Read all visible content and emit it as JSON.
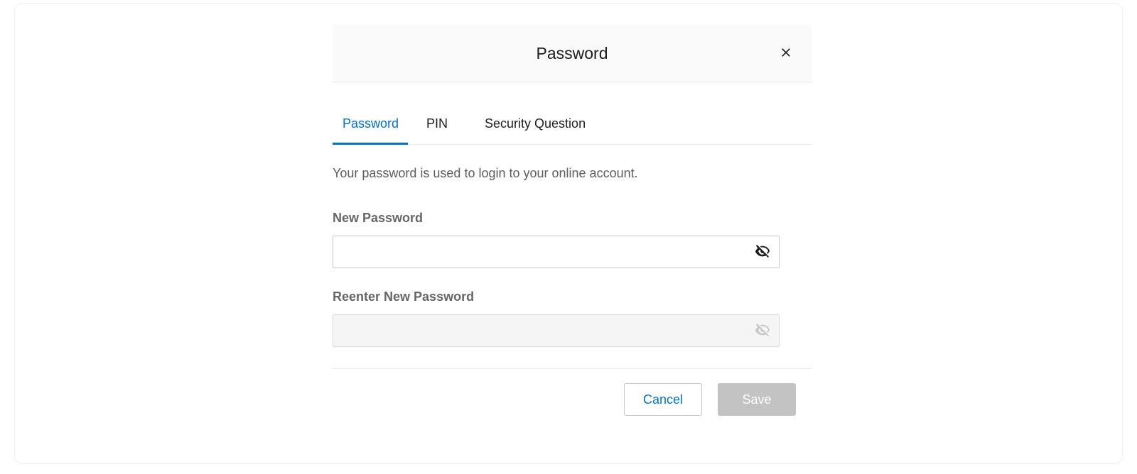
{
  "colors": {
    "primary": "#0073cf",
    "text": "#1d1d1d",
    "muted": "#5c5c5c",
    "label": "#666666",
    "border": "#c7c7c7",
    "disabled_bg": "#f5f5f5",
    "save_disabled_bg": "#c3c3c3"
  },
  "modal": {
    "title": "Password"
  },
  "tabs": [
    {
      "id": "password",
      "label": "Password",
      "active": true
    },
    {
      "id": "pin",
      "label": "PIN",
      "active": false
    },
    {
      "id": "security_question",
      "label": "Security Question",
      "active": false
    }
  ],
  "form": {
    "description": "Your password is used to login to your online account.",
    "fields": {
      "new_password": {
        "label": "New Password",
        "value": "",
        "visibility_toggle_enabled": true
      },
      "reenter_password": {
        "label": "Reenter New Password",
        "value": "",
        "disabled": true,
        "visibility_toggle_enabled": false
      }
    }
  },
  "footer": {
    "cancel_label": "Cancel",
    "save_label": "Save",
    "save_enabled": false
  }
}
